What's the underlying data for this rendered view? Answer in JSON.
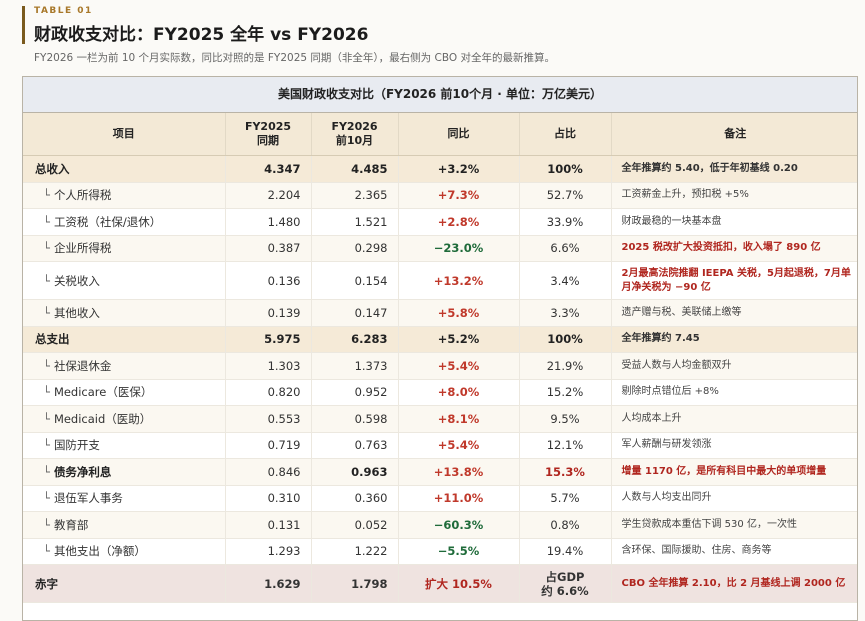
{
  "header": {
    "eyebrow": "TABLE 01",
    "title": "财政收支对比：FY2025 全年 vs FY2026",
    "subtitle": "FY2026 一栏为前 10 个月实际数，同比对照的是 FY2025 同期（非全年），最右侧为 CBO 对全年的最新推算。"
  },
  "table": {
    "caption": "美国财政收支对比（FY2026 前10个月 · 单位：万亿美元）",
    "columns": {
      "item": "项目",
      "fy2025": "FY2025\n同期",
      "fy2026": "FY2026\n前10月",
      "yoy": "同比",
      "share": "占比",
      "note": "备注"
    },
    "tee": "└",
    "rows": [
      {
        "item": "总收入",
        "fy2025": "4.347",
        "fy2026": "4.485",
        "yoy": "+3.2%",
        "share": "100%",
        "note": "全年推算约 5.40，低于年初基线 0.20"
      },
      {
        "item": "个人所得税",
        "fy2025": "2.204",
        "fy2026": "2.365",
        "yoy": "+7.3%",
        "share": "52.7%",
        "note": "工资薪金上升，预扣税 +5%"
      },
      {
        "item": "工资税（社保/退休）",
        "fy2025": "1.480",
        "fy2026": "1.521",
        "yoy": "+2.8%",
        "share": "33.9%",
        "note": "财政最稳的一块基本盘"
      },
      {
        "item": "企业所得税",
        "fy2025": "0.387",
        "fy2026": "0.298",
        "yoy": "−23.0%",
        "share": "6.6%",
        "note": "2025 税改扩大投资抵扣，收入塌了 890 亿"
      },
      {
        "item": "关税收入",
        "fy2025": "0.136",
        "fy2026": "0.154",
        "yoy": "+13.2%",
        "share": "3.4%",
        "note": "2月最高法院推翻 IEEPA 关税，5月起退税，7月单月净关税为 −90 亿"
      },
      {
        "item": "其他收入",
        "fy2025": "0.139",
        "fy2026": "0.147",
        "yoy": "+5.8%",
        "share": "3.3%",
        "note": "遗产赠与税、美联储上缴等"
      },
      {
        "item": "总支出",
        "fy2025": "5.975",
        "fy2026": "6.283",
        "yoy": "+5.2%",
        "share": "100%",
        "note": "全年推算约 7.45"
      },
      {
        "item": "社保退休金",
        "fy2025": "1.303",
        "fy2026": "1.373",
        "yoy": "+5.4%",
        "share": "21.9%",
        "note": "受益人数与人均金额双升"
      },
      {
        "item": "Medicare（医保）",
        "fy2025": "0.820",
        "fy2026": "0.952",
        "yoy": "+8.0%",
        "share": "15.2%",
        "note": "剔除时点错位后 +8%"
      },
      {
        "item": "Medicaid（医助）",
        "fy2025": "0.553",
        "fy2026": "0.598",
        "yoy": "+8.1%",
        "share": "9.5%",
        "note": "人均成本上升"
      },
      {
        "item": "国防开支",
        "fy2025": "0.719",
        "fy2026": "0.763",
        "yoy": "+5.4%",
        "share": "12.1%",
        "note": "军人薪酬与研发领涨"
      },
      {
        "item": "债务净利息",
        "fy2025": "0.846",
        "fy2026": "0.963",
        "yoy": "+13.8%",
        "share": "15.3%",
        "note": "增量 1170 亿，是所有科目中最大的单项增量"
      },
      {
        "item": "退伍军人事务",
        "fy2025": "0.310",
        "fy2026": "0.360",
        "yoy": "+11.0%",
        "share": "5.7%",
        "note": "人数与人均支出同升"
      },
      {
        "item": "教育部",
        "fy2025": "0.131",
        "fy2026": "0.052",
        "yoy": "−60.3%",
        "share": "0.8%",
        "note": "学生贷款成本重估下调 530 亿，一次性"
      },
      {
        "item": "其他支出（净额）",
        "fy2025": "1.293",
        "fy2026": "1.222",
        "yoy": "−5.5%",
        "share": "19.4%",
        "note": "含环保、国际援助、住房、商务等"
      },
      {
        "item": "赤字",
        "fy2025": "1.629",
        "fy2026": "1.798",
        "yoy": "扩大 10.5%",
        "share": "占GDP\n约 6.6%",
        "note": "CBO 全年推算 2.10，比 2 月基线上调 2000 亿"
      }
    ]
  }
}
